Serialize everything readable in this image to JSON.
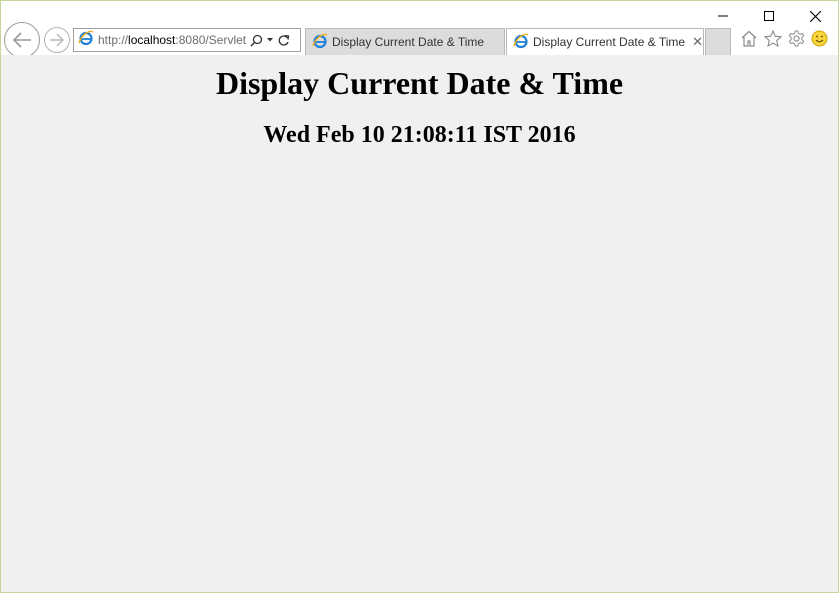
{
  "browser": {
    "address": {
      "prefix": "http://",
      "host": "localhost",
      "rest": ":8080/Servlet"
    },
    "tabs": [
      {
        "label": "Display Current Date & Time",
        "active": false
      },
      {
        "label": "Display Current Date & Time",
        "active": true
      }
    ],
    "tab_close_glyph": "✕",
    "icons": {
      "minimize": "minimize-icon",
      "maximize": "maximize-icon",
      "close": "close-icon",
      "back": "back-arrow-icon",
      "forward": "forward-arrow-icon",
      "search": "search-icon",
      "dropdown": "chevron-down-icon",
      "refresh": "refresh-icon",
      "home": "home-icon",
      "favorites": "star-icon",
      "settings": "gear-icon",
      "feedback": "smiley-icon",
      "page": "ie-icon"
    },
    "accent_color": "#1e7fd8"
  },
  "page": {
    "heading": "Display Current Date & Time",
    "datetime": "Wed Feb 10 21:08:11 IST 2016"
  }
}
